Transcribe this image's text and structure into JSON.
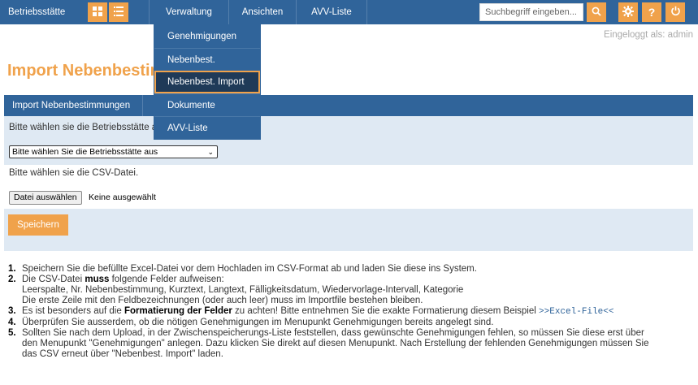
{
  "nav": {
    "brand": "Betriebsstätte",
    "items": [
      {
        "label": "Verwaltung"
      },
      {
        "label": "Ansichten"
      },
      {
        "label": "AVV-Liste"
      }
    ],
    "search_placeholder": "Suchbegriff eingeben...",
    "accent_color": "#f0a24b",
    "nav_color": "#30649a"
  },
  "dropdown": {
    "items": [
      {
        "label": "Genehmigungen"
      },
      {
        "label": "Nebenbest."
      },
      {
        "label": "Nebenbest. Import"
      },
      {
        "label": "Dokumente"
      },
      {
        "label": "AVV-Liste"
      }
    ],
    "active_label": "Nebenbest. Import"
  },
  "header": {
    "logged_in": "Eingeloggt als: admin",
    "page_title": "Import Nebenbestimmungen"
  },
  "panel": {
    "tab_label": "Import Nebenbestimmungen",
    "betriebsstaette_prompt": "Bitte wählen sie die Betriebsstätte aus",
    "select_value": "Bitte wählen Sie die Betriebsstätte aus",
    "csv_prompt": "Bitte wählen sie die CSV-Datei.",
    "file_button": "Datei auswählen",
    "file_status": "Keine ausgewählt",
    "save_button": "Speichern"
  },
  "instructions": {
    "i1": {
      "num": "1.",
      "text": "Speichern Sie die befüllte Excel-Datei vor dem Hochladen im CSV-Format ab und laden Sie diese ins System."
    },
    "i2": {
      "num": "2.",
      "pre": "Die CSV-Datei ",
      "bold": "muss",
      "post": " folgende Felder aufweisen:",
      "line2": "Leerspalte, Nr. Nebenbestimmung, Kurztext, Langtext, Fälligkeitsdatum, Wiedervorlage-Intervall, Kategorie",
      "line3": "Die erste Zeile mit den Feldbezeichnungen (oder auch leer) muss im Importfile bestehen bleiben."
    },
    "i3": {
      "num": "3.",
      "pre": "Es ist besonders auf die ",
      "bold": "Formatierung der Felder",
      "post": " zu achten! Bitte entnehmen Sie die exakte Formatierung diesem Beispiel ",
      "link": ">>Excel-File<<"
    },
    "i4": {
      "num": "4.",
      "text": "Überprüfen Sie ausserdem, ob die nötigen Genehmigungen im Menupunkt Genehmigungen bereits angelegt sind."
    },
    "i5": {
      "num": "5.",
      "line1": "Sollten Sie nach dem Upload, in der Zwischenspeicherungs-Liste feststellen, dass gewünschte Genehmigungen fehlen, so müssen Sie diese erst über",
      "line2": "den Menupunkt \"Genehmigungen\" anlegen. Dazu klicken Sie direkt auf diesen Menupunkt. Nach Erstellung der fehlenden Genehmigungen müssen Sie",
      "line3": "das CSV erneut über \"Nebenbest. Import\" laden."
    }
  }
}
